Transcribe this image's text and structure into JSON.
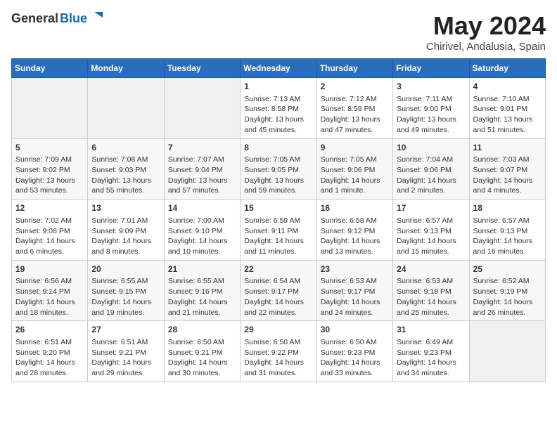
{
  "header": {
    "logo_general": "General",
    "logo_blue": "Blue",
    "title": "May 2024",
    "subtitle": "Chirivel, Andalusia, Spain"
  },
  "calendar": {
    "days_of_week": [
      "Sunday",
      "Monday",
      "Tuesday",
      "Wednesday",
      "Thursday",
      "Friday",
      "Saturday"
    ],
    "weeks": [
      [
        {
          "day": "",
          "data": ""
        },
        {
          "day": "",
          "data": ""
        },
        {
          "day": "",
          "data": ""
        },
        {
          "day": "1",
          "data": "Sunrise: 7:13 AM\nSunset: 8:58 PM\nDaylight: 13 hours\nand 45 minutes."
        },
        {
          "day": "2",
          "data": "Sunrise: 7:12 AM\nSunset: 8:59 PM\nDaylight: 13 hours\nand 47 minutes."
        },
        {
          "day": "3",
          "data": "Sunrise: 7:11 AM\nSunset: 9:00 PM\nDaylight: 13 hours\nand 49 minutes."
        },
        {
          "day": "4",
          "data": "Sunrise: 7:10 AM\nSunset: 9:01 PM\nDaylight: 13 hours\nand 51 minutes."
        }
      ],
      [
        {
          "day": "5",
          "data": "Sunrise: 7:09 AM\nSunset: 9:02 PM\nDaylight: 13 hours\nand 53 minutes."
        },
        {
          "day": "6",
          "data": "Sunrise: 7:08 AM\nSunset: 9:03 PM\nDaylight: 13 hours\nand 55 minutes."
        },
        {
          "day": "7",
          "data": "Sunrise: 7:07 AM\nSunset: 9:04 PM\nDaylight: 13 hours\nand 57 minutes."
        },
        {
          "day": "8",
          "data": "Sunrise: 7:05 AM\nSunset: 9:05 PM\nDaylight: 13 hours\nand 59 minutes."
        },
        {
          "day": "9",
          "data": "Sunrise: 7:05 AM\nSunset: 9:06 PM\nDaylight: 14 hours\nand 1 minute."
        },
        {
          "day": "10",
          "data": "Sunrise: 7:04 AM\nSunset: 9:06 PM\nDaylight: 14 hours\nand 2 minutes."
        },
        {
          "day": "11",
          "data": "Sunrise: 7:03 AM\nSunset: 9:07 PM\nDaylight: 14 hours\nand 4 minutes."
        }
      ],
      [
        {
          "day": "12",
          "data": "Sunrise: 7:02 AM\nSunset: 9:08 PM\nDaylight: 14 hours\nand 6 minutes."
        },
        {
          "day": "13",
          "data": "Sunrise: 7:01 AM\nSunset: 9:09 PM\nDaylight: 14 hours\nand 8 minutes."
        },
        {
          "day": "14",
          "data": "Sunrise: 7:00 AM\nSunset: 9:10 PM\nDaylight: 14 hours\nand 10 minutes."
        },
        {
          "day": "15",
          "data": "Sunrise: 6:59 AM\nSunset: 9:11 PM\nDaylight: 14 hours\nand 11 minutes."
        },
        {
          "day": "16",
          "data": "Sunrise: 6:58 AM\nSunset: 9:12 PM\nDaylight: 14 hours\nand 13 minutes."
        },
        {
          "day": "17",
          "data": "Sunrise: 6:57 AM\nSunset: 9:13 PM\nDaylight: 14 hours\nand 15 minutes."
        },
        {
          "day": "18",
          "data": "Sunrise: 6:57 AM\nSunset: 9:13 PM\nDaylight: 14 hours\nand 16 minutes."
        }
      ],
      [
        {
          "day": "19",
          "data": "Sunrise: 6:56 AM\nSunset: 9:14 PM\nDaylight: 14 hours\nand 18 minutes."
        },
        {
          "day": "20",
          "data": "Sunrise: 6:55 AM\nSunset: 9:15 PM\nDaylight: 14 hours\nand 19 minutes."
        },
        {
          "day": "21",
          "data": "Sunrise: 6:55 AM\nSunset: 9:16 PM\nDaylight: 14 hours\nand 21 minutes."
        },
        {
          "day": "22",
          "data": "Sunrise: 6:54 AM\nSunset: 9:17 PM\nDaylight: 14 hours\nand 22 minutes."
        },
        {
          "day": "23",
          "data": "Sunrise: 6:53 AM\nSunset: 9:17 PM\nDaylight: 14 hours\nand 24 minutes."
        },
        {
          "day": "24",
          "data": "Sunrise: 6:53 AM\nSunset: 9:18 PM\nDaylight: 14 hours\nand 25 minutes."
        },
        {
          "day": "25",
          "data": "Sunrise: 6:52 AM\nSunset: 9:19 PM\nDaylight: 14 hours\nand 26 minutes."
        }
      ],
      [
        {
          "day": "26",
          "data": "Sunrise: 6:51 AM\nSunset: 9:20 PM\nDaylight: 14 hours\nand 28 minutes."
        },
        {
          "day": "27",
          "data": "Sunrise: 6:51 AM\nSunset: 9:21 PM\nDaylight: 14 hours\nand 29 minutes."
        },
        {
          "day": "28",
          "data": "Sunrise: 6:50 AM\nSunset: 9:21 PM\nDaylight: 14 hours\nand 30 minutes."
        },
        {
          "day": "29",
          "data": "Sunrise: 6:50 AM\nSunset: 9:22 PM\nDaylight: 14 hours\nand 31 minutes."
        },
        {
          "day": "30",
          "data": "Sunrise: 6:50 AM\nSunset: 9:23 PM\nDaylight: 14 hours\nand 33 minutes."
        },
        {
          "day": "31",
          "data": "Sunrise: 6:49 AM\nSunset: 9:23 PM\nDaylight: 14 hours\nand 34 minutes."
        },
        {
          "day": "",
          "data": ""
        }
      ]
    ]
  }
}
